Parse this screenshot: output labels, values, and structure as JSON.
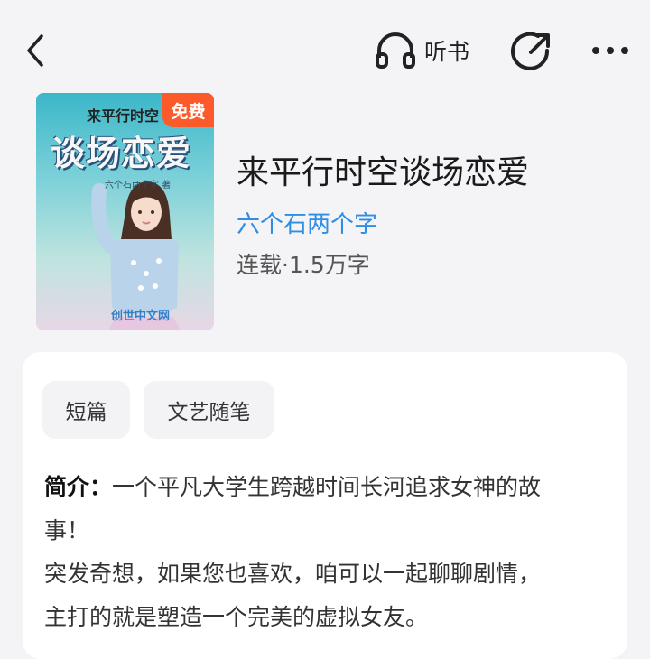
{
  "header": {
    "listen_label": "听书",
    "icons": {
      "back": "chevron-left-icon",
      "listen": "headphones-icon",
      "share": "share-icon",
      "more": "more-dots-icon"
    }
  },
  "book": {
    "title": "来平行时空谈场恋爱",
    "author": "六个石两个字",
    "meta": "连载·1.5万字",
    "cover": {
      "badge": "免费",
      "subtitle": "来平行时空",
      "title": "谈场恋爱",
      "author": "六个石两个字 著",
      "publisher": "创世中文网"
    }
  },
  "tags": [
    "短篇",
    "文艺随笔"
  ],
  "intro": {
    "label": "简介：",
    "lines": [
      "一个平凡大学生跨越时间长河追求女神的故",
      "事！",
      "突发奇想，如果您也喜欢，咱可以一起聊聊剧情，",
      "主打的就是塑造一个完美的虚拟女友。"
    ]
  },
  "colors": {
    "accent": "#2f8de4",
    "badge": "#fc5a2b",
    "background": "#f4f4f6"
  }
}
